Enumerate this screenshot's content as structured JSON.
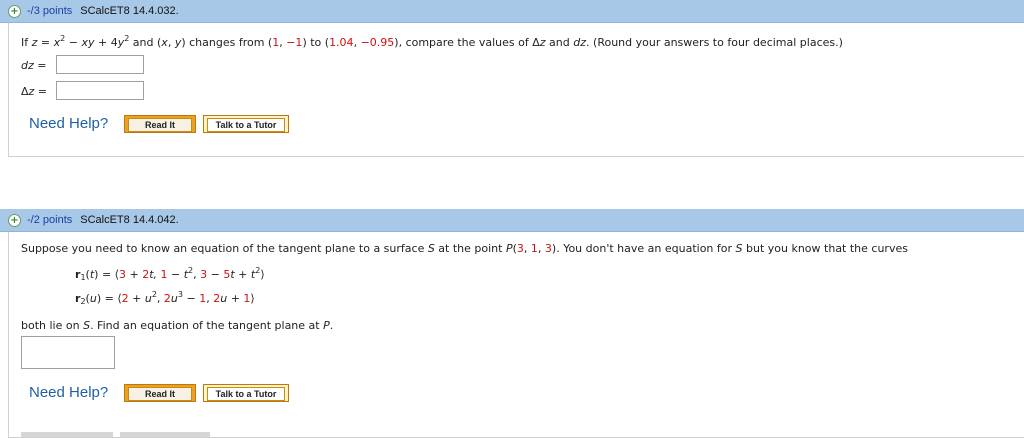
{
  "q1": {
    "points": "-/3 points",
    "code": "SCalcET8 14.4.032.",
    "prompt": {
      "p1": "If ",
      "fz": "z",
      "p2": " = ",
      "fx": "x",
      "sup2a": "2",
      "p3": " − ",
      "fxy": "xy",
      "p4": " + 4",
      "fy": "y",
      "sup2b": "2",
      "p5": " and (",
      "px": "x",
      "p6": ", ",
      "py": "y",
      "p7": ") changes from (",
      "from_x": "1",
      "p8": ", ",
      "from_y": "−1",
      "p9": ") to (",
      "to_x": "1.04",
      "p10": ", ",
      "to_y": "−0.95",
      "p11": "), compare the values of Δ",
      "dz1": "z",
      "p12": " and ",
      "dz2": "dz",
      "p13": ". (Round your answers to four decimal places.)"
    },
    "dz_label_var": "dz",
    "dz_label_eq": " =",
    "delta_label_pre": "Δ",
    "delta_label_var": "z",
    "delta_label_eq": " =",
    "need_help": "Need Help?",
    "read_it": "Read It",
    "talk_tutor": "Talk to a Tutor"
  },
  "q2": {
    "points": "-/2 points",
    "code": "SCalcET8 14.4.042.",
    "prompt": {
      "p1": "Suppose you need to know an equation of the tangent plane to a surface ",
      "S1": "S",
      "p2": " at the point ",
      "P": "P",
      "p3": "(",
      "c1": "3",
      "p4": ", ",
      "c2": "1",
      "p5": ", ",
      "c3": "3",
      "p6": "). You don't have an equation for ",
      "S2": "S",
      "p7": " but you know that the curves"
    },
    "r1": {
      "name": "r",
      "sub": "1",
      "arg": "t",
      "eq": " = ",
      "open": "⟨",
      "a1": "3",
      "a2": " + ",
      "a3": "2",
      "a4": "t, ",
      "b1": "1",
      "b2": " − ",
      "b3": "t",
      "b4": "2",
      "b5": ", ",
      "c1": "3",
      "c2": " − ",
      "c3": "5",
      "c4": "t",
      "c5": " + ",
      "c6": "t",
      "c7": "2",
      "close": "⟩"
    },
    "r2": {
      "name": "r",
      "sub": "2",
      "arg": "u",
      "eq": " = ",
      "open": "⟨",
      "a1": "2",
      "a2": " + ",
      "a3": "u",
      "a4": "2",
      "a5": ", ",
      "b1": "2",
      "b2": "u",
      "b3": "3",
      "b4": " − ",
      "b5": "1",
      "b6": ", ",
      "c1": "2",
      "c2": "u",
      "c3": " + ",
      "c4": "1",
      "close": "⟩"
    },
    "after1": "both lie on ",
    "afterS": "S",
    "after2": ". Find an equation of the tangent plane at ",
    "afterP": "P",
    "after3": ".",
    "need_help": "Need Help?",
    "read_it": "Read It",
    "talk_tutor": "Talk to a Tutor"
  },
  "colors": {
    "header_bg": "#a8c8e8",
    "points_text": "#1a3fa8",
    "highlight_red": "#cc1111",
    "need_help": "#1f5fa8",
    "read_button": "#f0a020"
  }
}
